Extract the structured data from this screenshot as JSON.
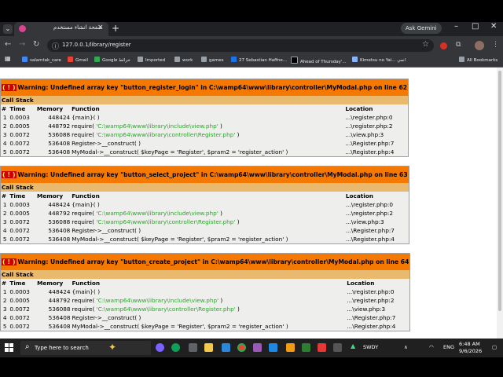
{
  "browser": {
    "tab_title": "صفحة انشاء مستخدم",
    "new_tab_label": "+",
    "tab_close": "×",
    "tab_list": "⌄",
    "gemini_label": "Ask Gemini",
    "minimize": "–",
    "maximize": "□",
    "close": "✕",
    "back": "←",
    "forward": "→",
    "reload": "↻",
    "url": "127.0.0.1/library/register",
    "site_info": "ⓘ",
    "star": "☆",
    "menu": "⋮",
    "extensions": "⧉"
  },
  "bookmarks": {
    "apps": "▦",
    "items": [
      {
        "label": "salamtak_care",
        "color": "#4285f4"
      },
      {
        "label": "Gmail",
        "color": "#ea4335"
      },
      {
        "label": "Google خرائط",
        "color": "#34a853"
      },
      {
        "label": "Imported",
        "color": "#9aa0a6"
      },
      {
        "label": "work",
        "color": "#9aa0a6"
      },
      {
        "label": "games",
        "color": "#9aa0a6"
      },
      {
        "label": "27 Sebastian Haffne...",
        "color": "#1a73e8"
      },
      {
        "label": "Ahead of Thursday'...",
        "color": "#000000"
      },
      {
        "label": "Kimetsu no Yai... انمي",
        "color": "#8ab4f8"
      }
    ],
    "all_bookmarks": "All Bookmarks"
  },
  "errors": [
    {
      "message": "Warning: Undefined array key \"button_register_login\" in C:\\wamp64\\www\\library\\controller\\MyModal.php on line 62",
      "rows": [
        {
          "n": "1",
          "time": "0.0003",
          "memory": "448424",
          "func": "{main}( )",
          "path": "",
          "loc": "...\\register.php:0"
        },
        {
          "n": "2",
          "time": "0.0005",
          "memory": "448792",
          "func": "require( ",
          "path": "'C:\\wamp64\\www\\library\\include\\view.php'",
          "loc": "...\\register.php:2"
        },
        {
          "n": "3",
          "time": "0.0072",
          "memory": "536088",
          "func": "require( ",
          "path": "'C:\\wamp64\\www\\library\\controller\\Register.php'",
          "loc": "...\\view.php:3"
        },
        {
          "n": "4",
          "time": "0.0072",
          "memory": "536408",
          "func": "Register->__construct( )",
          "path": "",
          "loc": "...\\Register.php:7"
        },
        {
          "n": "5",
          "time": "0.0072",
          "memory": "536408",
          "func": "MyModal->__construct( $keyPage = 'Register', $pram2 = 'register_action' )",
          "path": "",
          "loc": "...\\Register.php:4"
        }
      ]
    },
    {
      "message": "Warning: Undefined array key \"button_select_project\" in C:\\wamp64\\www\\library\\controller\\MyModal.php on line 63",
      "rows": [
        {
          "n": "1",
          "time": "0.0003",
          "memory": "448424",
          "func": "{main}( )",
          "path": "",
          "loc": "...\\register.php:0"
        },
        {
          "n": "2",
          "time": "0.0005",
          "memory": "448792",
          "func": "require( ",
          "path": "'C:\\wamp64\\www\\library\\include\\view.php'",
          "loc": "...\\register.php:2"
        },
        {
          "n": "3",
          "time": "0.0072",
          "memory": "536088",
          "func": "require( ",
          "path": "'C:\\wamp64\\www\\library\\controller\\Register.php'",
          "loc": "...\\view.php:3"
        },
        {
          "n": "4",
          "time": "0.0072",
          "memory": "536408",
          "func": "Register->__construct( )",
          "path": "",
          "loc": "...\\Register.php:7"
        },
        {
          "n": "5",
          "time": "0.0072",
          "memory": "536408",
          "func": "MyModal->__construct( $keyPage = 'Register', $pram2 = 'register_action' )",
          "path": "",
          "loc": "...\\Register.php:4"
        }
      ]
    },
    {
      "message": "Warning: Undefined array key \"button_create_project\" in C:\\wamp64\\www\\library\\controller\\MyModal.php on line 64",
      "rows": [
        {
          "n": "1",
          "time": "0.0003",
          "memory": "448424",
          "func": "{main}( )",
          "path": "",
          "loc": "...\\register.php:0"
        },
        {
          "n": "2",
          "time": "0.0005",
          "memory": "448792",
          "func": "require( ",
          "path": "'C:\\wamp64\\www\\library\\include\\view.php'",
          "loc": "...\\register.php:2"
        },
        {
          "n": "3",
          "time": "0.0072",
          "memory": "536088",
          "func": "require( ",
          "path": "'C:\\wamp64\\www\\library\\controller\\Register.php'",
          "loc": "...\\view.php:3"
        },
        {
          "n": "4",
          "time": "0.0072",
          "memory": "536408",
          "func": "Register->__construct( )",
          "path": "",
          "loc": "...\\Register.php:7"
        },
        {
          "n": "5",
          "time": "0.0072",
          "memory": "536408",
          "func": "MyModal->__construct( $keyPage = 'Register', $pram2 = 'register_action' )",
          "path": "",
          "loc": "...\\Register.php:4"
        }
      ]
    }
  ],
  "table_labels": {
    "bang": "( ! )",
    "call_stack": "Call Stack",
    "col_num": "#",
    "col_time": "Time",
    "col_memory": "Memory",
    "col_function": "Function",
    "col_location": "Location",
    "close_paren": " )"
  },
  "taskbar": {
    "search_placeholder": "Type here to search",
    "search_icon": "⌕",
    "spark": "✦",
    "stock_label": "SWDY",
    "stock_arrow": "▲",
    "lang": "ENG",
    "time": "6:48 AM",
    "date": "9/6/2026",
    "tray_up": "∧"
  },
  "colors": {
    "warning_header": "#f57900",
    "call_stack_header": "#e9b96e",
    "row_bg": "#eeeeec",
    "path_green": "#2ca62c",
    "bang_red": "#cc0000"
  }
}
